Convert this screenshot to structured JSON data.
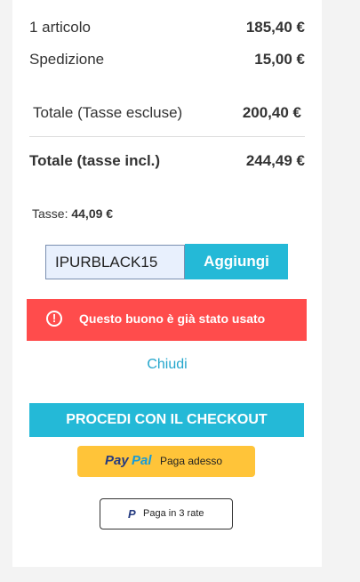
{
  "summary": {
    "items_label": "1 articolo",
    "items_value": "185,40 €",
    "shipping_label": "Spedizione",
    "shipping_value": "15,00 €",
    "subtotal_label": "Totale (Tasse escluse)",
    "subtotal_value": "200,40 €",
    "total_label": "Totale (tasse incl.)",
    "total_value": "244,49 €",
    "taxes_label": "Tasse:",
    "taxes_value": "44,09 €"
  },
  "coupon": {
    "input_value": "IPURBLACK15",
    "button_label": "Aggiungi"
  },
  "error": {
    "icon": "alert-circle-icon",
    "message": "Questo buono è già stato usato"
  },
  "close_label": "Chiudi",
  "checkout_label": "PROCEDI CON IL CHECKOUT",
  "paypal": {
    "logo_pay": "Pay",
    "logo_pal": "Pal",
    "label": "Paga adesso"
  },
  "paypal_installments": {
    "label": "Paga in 3 rate"
  },
  "colors": {
    "accent": "#24b9d7",
    "error": "#ff4c4c",
    "paypal_yellow": "#ffc439"
  }
}
